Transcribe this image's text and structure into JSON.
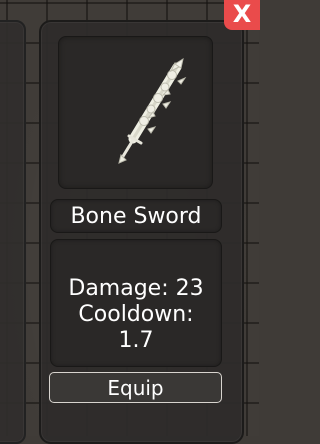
{
  "close_button": {
    "label": "X",
    "color": "#ea4b4b"
  },
  "item": {
    "name": "Bone Sword",
    "icon": "bone-sword-icon",
    "damage_text": "Damage: 23",
    "cooldown_label": "Cooldown:",
    "cooldown_value": "1.7"
  },
  "equip_button": {
    "label": "Equip"
  }
}
